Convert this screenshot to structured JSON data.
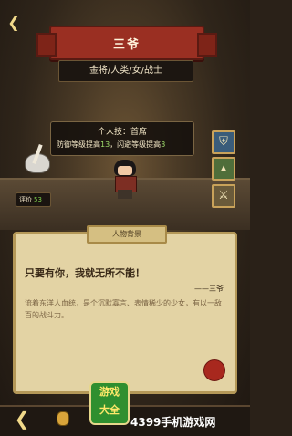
{
  "header": {
    "name": "三爷",
    "subtitle": "金将/人类/女/战士"
  },
  "skill": {
    "title": "个人技：首席",
    "desc_prefix": "防御等级提高",
    "def_value": "13",
    "desc_middle": "，闪避等级提高",
    "dodge_value": "3"
  },
  "rating": {
    "label": "评价",
    "value": "53"
  },
  "panel": {
    "tab_label": "人物背景",
    "quote": "只要有你，我就无所不能！",
    "signature": "——三爷",
    "description": "流着东洋人血统，是个沉默寡言、表情稀少的少女，有以一敌百的战斗力。"
  },
  "watermark": {
    "logo_line1": "游戏",
    "logo_line2": "大全",
    "site": "4399手机游戏网"
  },
  "icons": {
    "top_back": "back-arrow-icon",
    "side": [
      "shield-icon",
      "armor-icon",
      "crossed-swords-icon"
    ],
    "bottom_back": "back-arrow-icon"
  },
  "colors": {
    "banner": "#9a2f22",
    "parchment": "#e3d3a4",
    "stat_green": "#9fdc6b"
  }
}
